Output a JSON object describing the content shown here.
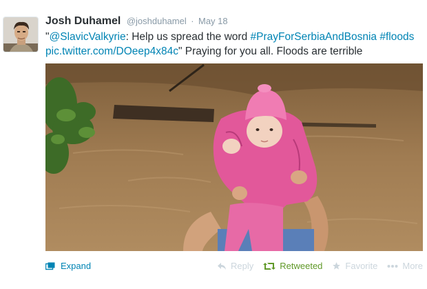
{
  "tweet": {
    "fullname": "Josh Duhamel",
    "username": "@joshduhamel",
    "separator": "·",
    "time": "May 18",
    "text": {
      "q1": "\"",
      "mention": "@SlavicValkyrie",
      "t1": ": Help us spread the word ",
      "hashtag1": "#PrayForSerbiaAndBosnia",
      "t2": " ",
      "hashtag2": "#floods",
      "piclink": "pic.twitter.com/DOeep4x84c",
      "t3": "\" Praying for you all. Floods are terrible"
    }
  },
  "actions": {
    "expand": "Expand",
    "reply": "Reply",
    "retweeted": "Retweeted",
    "favorite": "Favorite",
    "more": "More"
  },
  "icons": {
    "expand": "expand-icon",
    "reply": "reply-icon",
    "retweet": "retweet-icon",
    "favorite": "star-icon",
    "more": "more-dots-icon"
  },
  "colors": {
    "link": "#0084b4",
    "retweeted": "#609928",
    "muted": "#8899a6",
    "inactive_action": "#ccd6dd",
    "text": "#292f33"
  }
}
